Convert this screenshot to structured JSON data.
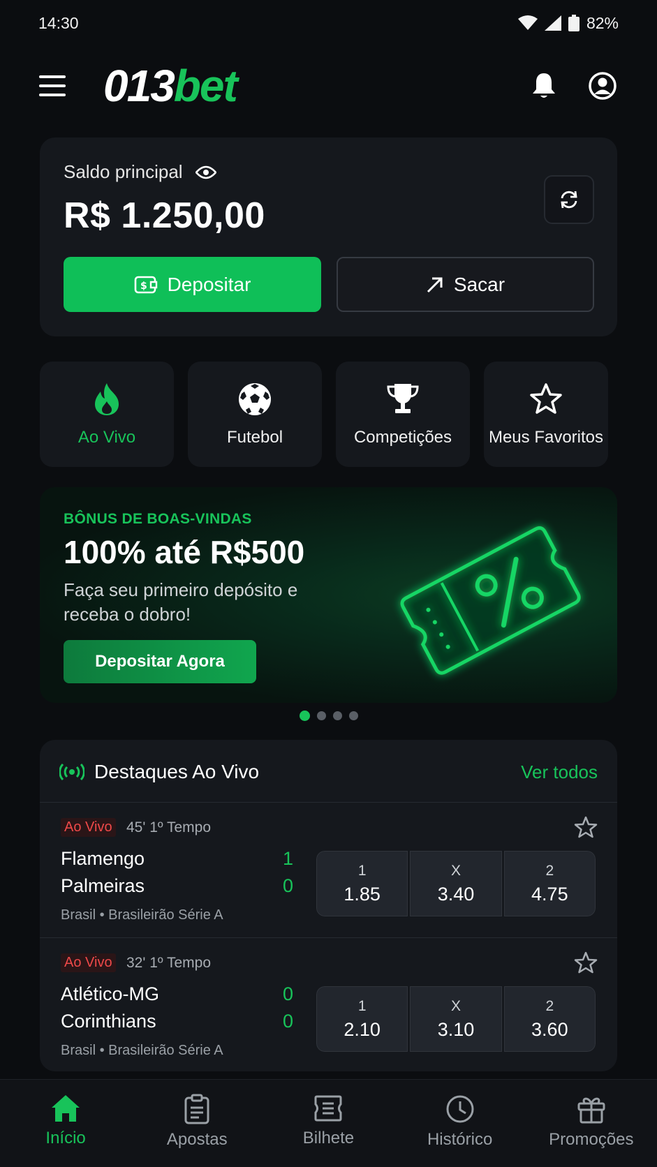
{
  "status_bar": {
    "time": "14:30",
    "battery": "82%"
  },
  "header": {
    "logo_part1": "013",
    "logo_part2": "bet",
    "icons": [
      "menu-icon",
      "bell-icon",
      "user-icon"
    ]
  },
  "balance": {
    "label": "Saldo principal",
    "value": "R$ 1.250,00",
    "deposit_label": "Depositar",
    "withdraw_label": "Sacar"
  },
  "quick_nav": [
    {
      "label": "Ao Vivo",
      "icon": "flame-icon",
      "active": true
    },
    {
      "label": "Futebol",
      "icon": "soccer-ball-icon",
      "active": false
    },
    {
      "label": "Competições",
      "icon": "trophy-icon",
      "active": false
    },
    {
      "label": "Meus Favoritos",
      "icon": "star-icon",
      "active": false
    }
  ],
  "banner": {
    "tag": "BÔNUS DE BOAS-VINDAS",
    "title": "100% até R$500",
    "description": "Faça seu primeiro depósito e receba o dobro!",
    "button_label": "Depositar Agora",
    "slides": 4,
    "active_slide": 1
  },
  "live": {
    "title": "Destaques Ao Vivo",
    "see_all": "Ver todos",
    "matches": [
      {
        "badge": "Ao Vivo",
        "time": "45' 1º Tempo",
        "home": "Flamengo",
        "away": "Palmeiras",
        "home_score": "1",
        "away_score": "0",
        "league": "Brasil • Brasileirão Série A",
        "odds": [
          {
            "label": "1",
            "value": "1.85"
          },
          {
            "label": "X",
            "value": "3.40"
          },
          {
            "label": "2",
            "value": "4.75"
          }
        ]
      },
      {
        "badge": "Ao Vivo",
        "time": "32' 1º Tempo",
        "home": "Atlético-MG",
        "away": "Corinthians",
        "home_score": "0",
        "away_score": "0",
        "league": "Brasil • Brasileirão Série A",
        "odds": [
          {
            "label": "1",
            "value": "2.10"
          },
          {
            "label": "X",
            "value": "3.10"
          },
          {
            "label": "2",
            "value": "3.60"
          }
        ]
      }
    ]
  },
  "bottom_nav": [
    {
      "label": "Início",
      "icon": "home-icon",
      "active": true
    },
    {
      "label": "Apostas",
      "icon": "clipboard-icon",
      "active": false
    },
    {
      "label": "Bilhete",
      "icon": "ticket-icon",
      "active": false
    },
    {
      "label": "Histórico",
      "icon": "clock-icon",
      "active": false
    },
    {
      "label": "Promoções",
      "icon": "gift-icon",
      "active": false
    }
  ],
  "colors": {
    "accent": "#18c35a",
    "background": "#0b0d10",
    "card": "#15181d",
    "live_red": "#ee4949"
  }
}
